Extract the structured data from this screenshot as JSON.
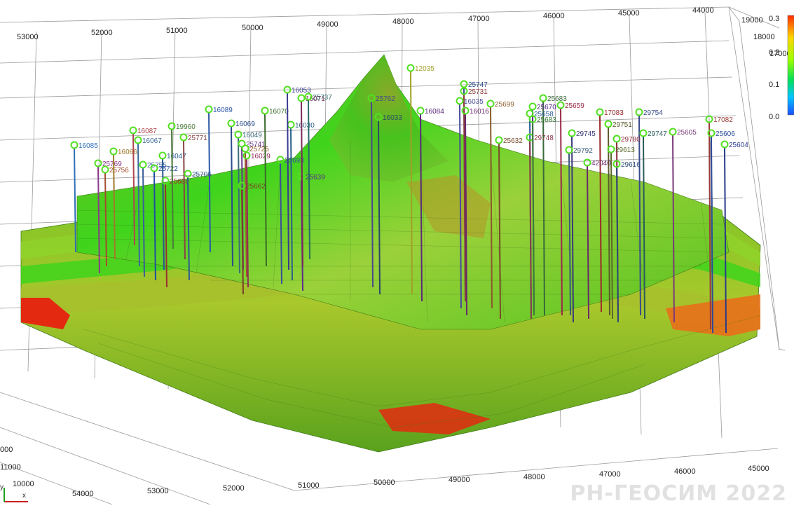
{
  "top_axis_ticks": [
    "53000",
    "52000",
    "51000",
    "50000",
    "49000",
    "48000",
    "47000",
    "46000",
    "45000",
    "44000"
  ],
  "right_axis_ticks": [
    "19000",
    "18000",
    "17000"
  ],
  "left_axis_ticks": [
    "11000",
    "10000"
  ],
  "bottom_front_ticks": [
    "54000",
    "53000",
    "52000",
    "51000",
    "50000",
    "49000",
    "48000",
    "47000",
    "46000",
    "45000"
  ],
  "colorbar": {
    "labels": [
      "0.3",
      "0.2",
      "0.1",
      "0.0"
    ],
    "stops": [
      "#ff2a00",
      "#ffd500",
      "#9aff00",
      "#00e05a",
      "#00c4ff",
      "#1a4dff"
    ]
  },
  "watermark": "РН-ГЕОСИМ 2022",
  "gizmo": {
    "x": "x",
    "y": "y"
  },
  "colors": {
    "layer_dark": "#5b8a1f",
    "layer_green": "#4fd11f",
    "layer_yellow": "#a9c92a",
    "red_zone": "#e32a10",
    "grid": "#9a9a9a"
  },
  "wells": [
    {
      "id": "16085",
      "color": "#2f6fb6"
    },
    {
      "id": "25769",
      "color": "#8a3a8a"
    },
    {
      "id": "25756",
      "color": "#a34d2e"
    },
    {
      "id": "16066",
      "color": "#a07a2a"
    },
    {
      "id": "16087",
      "color": "#b0454c"
    },
    {
      "id": "16067",
      "color": "#3b6a9b"
    },
    {
      "id": "25755",
      "color": "#3a5f9a"
    },
    {
      "id": "25722",
      "color": "#1f4fa0"
    },
    {
      "id": "16047",
      "color": "#28578f"
    },
    {
      "id": "25688",
      "color": "#9a3030"
    },
    {
      "id": "19960",
      "color": "#4a7a3a"
    },
    {
      "id": "25771",
      "color": "#8a4444"
    },
    {
      "id": "16089",
      "color": "#2d59a6"
    },
    {
      "id": "16069",
      "color": "#2b4d8a"
    },
    {
      "id": "16049",
      "color": "#3a6b7a"
    },
    {
      "id": "25741",
      "color": "#6a3a8a"
    },
    {
      "id": "25725",
      "color": "#9a5a2a"
    },
    {
      "id": "25706",
      "color": "#2e5a8f"
    },
    {
      "id": "16029",
      "color": "#8f2e5a"
    },
    {
      "id": "25662",
      "color": "#7a3f2a"
    },
    {
      "id": "25693",
      "color": "#3a4f9a"
    },
    {
      "id": "25639",
      "color": "#5a2e8a"
    },
    {
      "id": "16070",
      "color": "#3a6b2a"
    },
    {
      "id": "16030",
      "color": "#2a5f8a"
    },
    {
      "id": "16071",
      "color": "#7a2a5a"
    },
    {
      "id": "25737",
      "color": "#2a6a6a"
    },
    {
      "id": "16053",
      "color": "#3a3a8f"
    },
    {
      "id": "25747",
      "color": "#2f4f8f"
    },
    {
      "id": "25731",
      "color": "#8a3a3a"
    },
    {
      "id": "16035",
      "color": "#4a4a9a"
    },
    {
      "id": "16016",
      "color": "#6a2a6a"
    },
    {
      "id": "25699",
      "color": "#8a5a2a"
    },
    {
      "id": "25683",
      "color": "#3a6a3a"
    },
    {
      "id": "25670",
      "color": "#5a2a8a"
    },
    {
      "id": "25658",
      "color": "#2a5a9a"
    },
    {
      "id": "25659",
      "color": "#9a2a4a"
    },
    {
      "id": "25632",
      "color": "#7a4a2a"
    },
    {
      "id": "29748",
      "color": "#8a3a4a"
    },
    {
      "id": "29745",
      "color": "#3a3a7a"
    },
    {
      "id": "17083",
      "color": "#9a2a2a"
    },
    {
      "id": "29754",
      "color": "#3a4a8a"
    },
    {
      "id": "29751",
      "color": "#5a5a2a"
    },
    {
      "id": "29780",
      "color": "#8a2a3a"
    },
    {
      "id": "29747",
      "color": "#2a5a5a"
    },
    {
      "id": "25605",
      "color": "#7a3a7a"
    },
    {
      "id": "17082",
      "color": "#9a3a3a"
    },
    {
      "id": "25606",
      "color": "#2a4a9a"
    },
    {
      "id": "25604",
      "color": "#2a3a8a"
    },
    {
      "id": "29613",
      "color": "#5a6a2a"
    },
    {
      "id": "29616",
      "color": "#2a4a7a"
    },
    {
      "id": "42040",
      "color": "#6a2a6a"
    },
    {
      "id": "29792",
      "color": "#3a5a7a"
    },
    {
      "id": "25683",
      "color": "#3a7a3a"
    },
    {
      "id": "16084",
      "color": "#5a2a7a"
    },
    {
      "id": "12035",
      "color": "#a0a02a"
    },
    {
      "id": "25762",
      "color": "#4a4a8a"
    },
    {
      "id": "16033",
      "color": "#2a4a6a"
    }
  ]
}
